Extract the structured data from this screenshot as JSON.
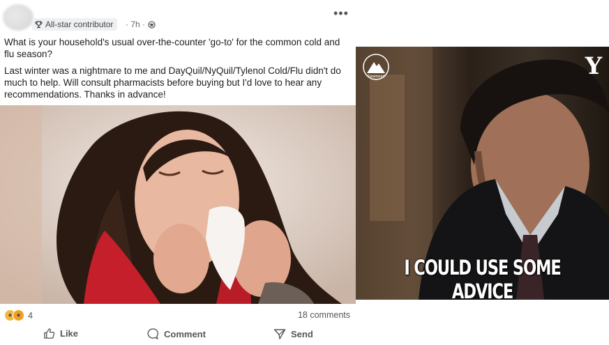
{
  "post": {
    "badge_label": "All-star contributor",
    "time": "· 7h ·",
    "more_label": "•••",
    "question": "What is your household's usual over-the-counter 'go-to' for the common cold and flu season?",
    "body": "Last winter was a nightmare to me and DayQuil/NyQuil/Tylenol Cold/Flu didn't do much to help.  Will consult pharmacists before buying but I'd love to hear any recommendations. Thanks in advance!",
    "reaction_count": "4",
    "comments_count": "18 comments",
    "actions": {
      "like": "Like",
      "comment": "Comment",
      "send": "Send"
    }
  },
  "gif": {
    "caption": "I COULD USE SOME ADVICE",
    "logo_left_text": "Paramount",
    "logo_left_sub": "NETWORK",
    "logo_right": "Y"
  }
}
